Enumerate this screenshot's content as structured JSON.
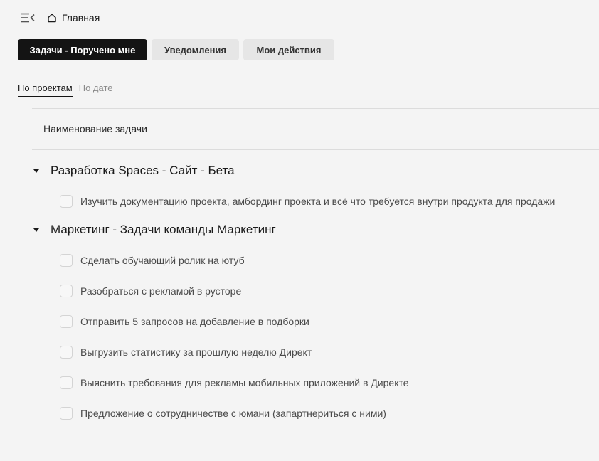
{
  "header": {
    "menu_icon": "menu-collapse-icon",
    "breadcrumb_icon": "home-icon",
    "breadcrumb_label": "Главная"
  },
  "tabs": [
    {
      "label": "Задачи - Поручено мне",
      "active": true
    },
    {
      "label": "Уведомления",
      "active": false
    },
    {
      "label": "Мои действия",
      "active": false
    }
  ],
  "subtabs": [
    {
      "label": "По проектам",
      "active": true
    },
    {
      "label": "По дате",
      "active": false
    }
  ],
  "table": {
    "column_header": "Наименование задачи"
  },
  "groups": [
    {
      "title": "Разработка Spaces - Сайт - Бета",
      "tasks": [
        "Изучить документацию проекта, амбординг проекта и всё что требуется внутри продукта для продажи"
      ]
    },
    {
      "title": "Маркетинг - Задачи команды Маркетинг",
      "tasks": [
        "Сделать обучающий ролик на ютуб",
        "Разобраться с рекламой в русторе",
        "Отправить 5 запросов на добавление в подборки",
        "Выгрузить статистику за прошлую неделю Директ",
        "Выяснить требования для рекламы мобильных приложений в Директе",
        "Предложение о сотрудничестве с юмани (запартнериться с ними)"
      ]
    }
  ],
  "colors": {
    "background": "#f4f4f4",
    "active_tab": "#141414",
    "inactive_tab": "#e6e6e6"
  }
}
